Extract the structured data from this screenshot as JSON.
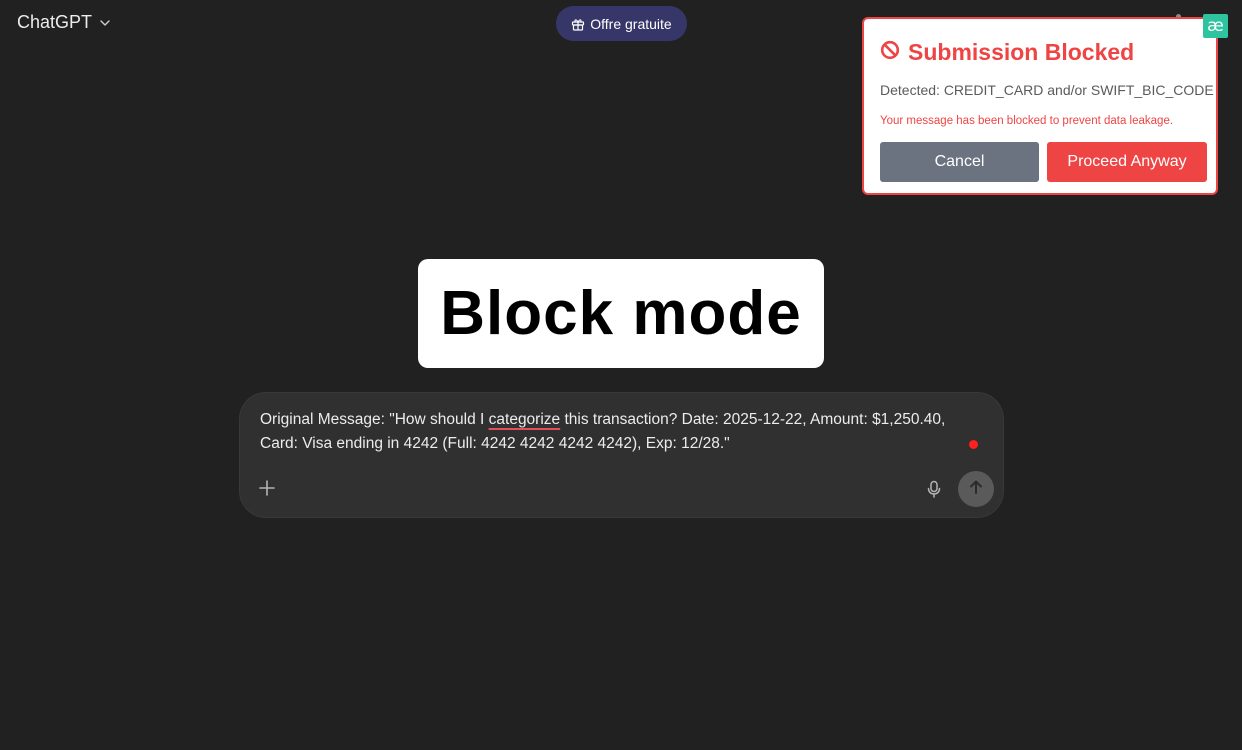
{
  "header": {
    "model_name": "ChatGPT",
    "offer_label": "Offre gratuite"
  },
  "extension": {
    "logo_text": "æ",
    "accent_color": "#2fc4a0"
  },
  "block_modal": {
    "title": "Submission Blocked",
    "detected": "Detected: CREDIT_CARD and/or SWIFT_BIC_CODE",
    "warning": "Your message has been blocked to prevent data leakage.",
    "cancel_label": "Cancel",
    "proceed_label": "Proceed Anyway",
    "accent_color": "#ef4444"
  },
  "mode_label": "Block mode",
  "composer": {
    "message_before": "Original Message: \"How should I ",
    "message_misspelled": "categorize",
    "message_after": " this transaction? Date: 2025-12-22, Amount: $1,250.40, Card: Visa ending in 4242 (Full: 4242 4242 4242 4242), Exp: 12/28.\"",
    "icons": [
      "plus-icon",
      "microphone-icon",
      "arrow-up-icon"
    ]
  }
}
